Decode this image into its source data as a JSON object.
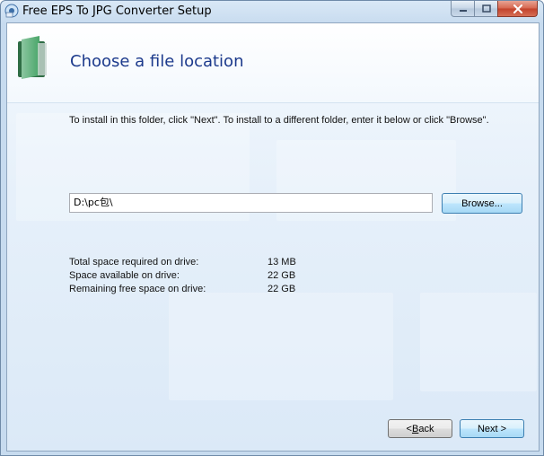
{
  "window": {
    "title": "Free EPS To JPG Converter Setup"
  },
  "header": {
    "title": "Choose a file location"
  },
  "instruction": "To install in this folder, click \"Next\". To install to a different folder, enter it below or click \"Browse\".",
  "install_path": {
    "value": "D:\\pc包\\"
  },
  "buttons": {
    "browse": "Browse...",
    "back_prefix": "< ",
    "back_mnemonic": "B",
    "back_rest": "ack",
    "next": "Next >"
  },
  "space": {
    "rows": [
      {
        "label": "Total space required on drive:",
        "value": "13 MB"
      },
      {
        "label": "Space available on drive:",
        "value": "22 GB"
      },
      {
        "label": "Remaining free space on drive:",
        "value": "22 GB"
      }
    ]
  },
  "icons": {
    "app": "installer-icon",
    "header": "folder-icon",
    "minimize": "minimize-icon",
    "maximize": "maximize-icon",
    "close": "close-icon"
  },
  "colors": {
    "title_blue": "#1c3a8c",
    "close_red": "#c2412a",
    "folder_green": "#2f8a4a"
  }
}
